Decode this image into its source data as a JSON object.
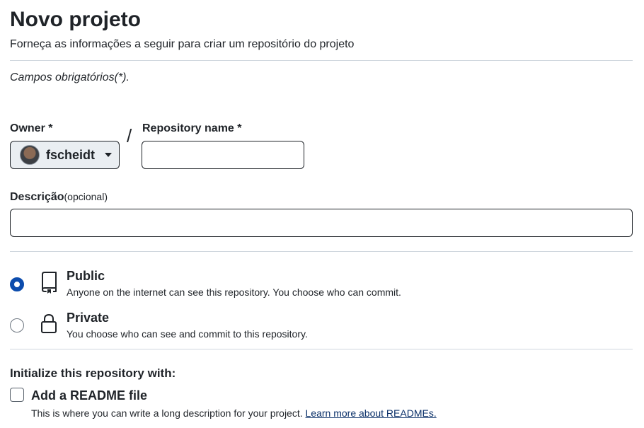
{
  "header": {
    "title": "Novo projeto",
    "subtitle": "Forneça as informações a seguir para criar um repositório do projeto"
  },
  "required_note": "Campos obrigatórios(*).",
  "owner": {
    "label": "Owner *",
    "value": "fscheidt"
  },
  "separator": "/",
  "repository_name": {
    "label": "Repository name *",
    "value": ""
  },
  "description": {
    "label": "Descrição",
    "optional": "(opcional)",
    "value": ""
  },
  "visibility": {
    "selected": "public",
    "options": [
      {
        "id": "public",
        "title": "Public",
        "description": "Anyone on the internet can see this repository. You choose who can commit.",
        "icon": "repo-icon"
      },
      {
        "id": "private",
        "title": "Private",
        "description": "You choose who can see and commit to this repository.",
        "icon": "lock-icon"
      }
    ]
  },
  "initialize": {
    "heading": "Initialize this repository with:",
    "readme": {
      "label": "Add a README file",
      "checked": false,
      "description": "This is where you can write a long description for your project.",
      "link_text": "Learn more about READMEs."
    }
  },
  "colors": {
    "accent_radio": "#0c4cad",
    "link": "#0a3069",
    "divider": "#d0d7de",
    "owner_button_bg": "#eaeef2"
  }
}
